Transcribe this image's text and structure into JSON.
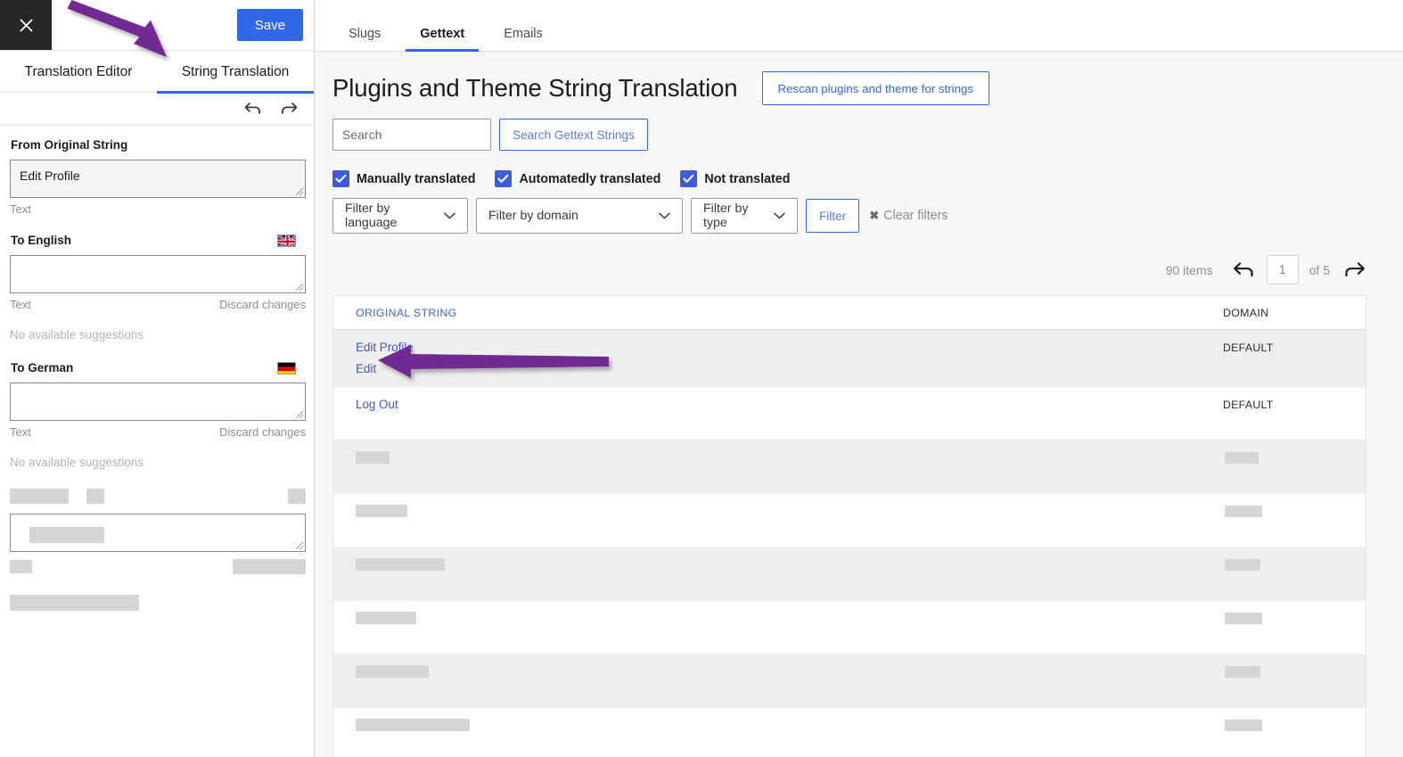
{
  "left_panel": {
    "close_icon": "close-icon",
    "save_label": "Save",
    "undo_icon": "undo-arrow-icon",
    "redo_icon": "redo-arrow-icon",
    "tabs": [
      {
        "label": "Translation Editor",
        "active": false
      },
      {
        "label": "String Translation",
        "active": true
      }
    ],
    "from_section": {
      "label": "From Original String",
      "value": "Edit Profile",
      "hint": "Text"
    },
    "to_english": {
      "label": "To English",
      "flag": "uk-flag-icon",
      "value": "",
      "hint": "Text",
      "discard_label": "Discard changes",
      "suggestions": "No available suggestions"
    },
    "to_german": {
      "label": "To German",
      "flag": "german-flag-icon",
      "value": "",
      "hint": "Text",
      "discard_label": "Discard changes",
      "suggestions": "No available suggestions"
    }
  },
  "top_tabs": [
    {
      "label": "Slugs",
      "active": false
    },
    {
      "label": "Gettext",
      "active": true
    },
    {
      "label": "Emails",
      "active": false
    }
  ],
  "main": {
    "page_title": "Plugins and Theme String Translation",
    "rescan_label": "Rescan plugins and theme for strings",
    "search_placeholder": "Search",
    "search_value": "",
    "search_button_label": "Search Gettext Strings",
    "checkboxes": [
      {
        "label": "Manually translated",
        "checked": true
      },
      {
        "label": "Automatedly translated",
        "checked": true
      },
      {
        "label": "Not translated",
        "checked": true
      }
    ],
    "selects": [
      {
        "label": "Filter by language",
        "name": "filter-by-language"
      },
      {
        "label": "Filter by domain",
        "name": "filter-by-domain"
      },
      {
        "label": "Filter by type",
        "name": "filter-by-type"
      }
    ],
    "filter_button_label": "Filter",
    "clear_filters_label": "Clear filters",
    "clear_filters_x": "✖"
  },
  "pagination": {
    "items_label": "90 items",
    "prev_icon": "prev-page-arrow-icon",
    "next_icon": "next-page-arrow-icon",
    "current_page": "1",
    "of_label": "of 5"
  },
  "table": {
    "headers": {
      "original_string": "ORIGINAL STRING",
      "domain": "DOMAIN"
    },
    "rows": [
      {
        "string": "Edit Profile",
        "action": "Edit",
        "domain": "DEFAULT",
        "alt": true,
        "skeleton": false
      },
      {
        "string": "Log Out",
        "action": "",
        "domain": "DEFAULT",
        "alt": false,
        "skeleton": false
      },
      {
        "string": "",
        "action": "",
        "domain": "",
        "alt": true,
        "skeleton": true,
        "sk_w": 38,
        "sk_d": 38
      },
      {
        "string": "",
        "action": "",
        "domain": "",
        "alt": false,
        "skeleton": true,
        "sk_w": 58,
        "sk_d": 42
      },
      {
        "string": "",
        "action": "",
        "domain": "",
        "alt": true,
        "skeleton": true,
        "sk_w": 100,
        "sk_d": 40
      },
      {
        "string": "",
        "action": "",
        "domain": "",
        "alt": false,
        "skeleton": true,
        "sk_w": 68,
        "sk_d": 42
      },
      {
        "string": "",
        "action": "",
        "domain": "",
        "alt": true,
        "skeleton": true,
        "sk_w": 82,
        "sk_d": 40
      },
      {
        "string": "",
        "action": "",
        "domain": "",
        "alt": false,
        "skeleton": true,
        "sk_w": 128,
        "sk_d": 42
      }
    ]
  },
  "annotations": {
    "arrow_color": "#6f2c91",
    "arrow_1_target": "String Translation tab",
    "arrow_2_target": "Edit link"
  }
}
